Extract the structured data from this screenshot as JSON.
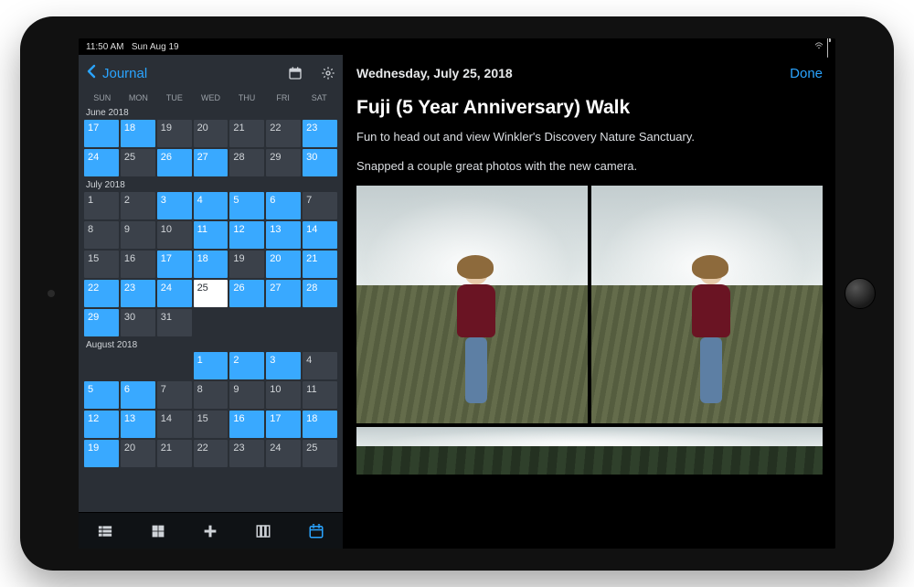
{
  "statusbar": {
    "time": "11:50 AM",
    "date": "Sun Aug 19"
  },
  "sidebar": {
    "back_label": "Journal",
    "weekdays": [
      "SUN",
      "MON",
      "TUE",
      "WED",
      "THU",
      "FRI",
      "SAT"
    ]
  },
  "calendar": {
    "months": [
      {
        "label": "June 2018",
        "rows": [
          [
            {
              "n": 17,
              "hl": true
            },
            {
              "n": 18,
              "hl": true
            },
            {
              "n": 19
            },
            {
              "n": 20
            },
            {
              "n": 21
            },
            {
              "n": 22
            },
            {
              "n": 23,
              "hl": true
            }
          ],
          [
            {
              "n": 24,
              "hl": true
            },
            {
              "n": 25
            },
            {
              "n": 26,
              "hl": true
            },
            {
              "n": 27,
              "hl": true
            },
            {
              "n": 28
            },
            {
              "n": 29
            },
            {
              "n": 30,
              "hl": true
            }
          ]
        ]
      },
      {
        "label": "July 2018",
        "rows": [
          [
            {
              "n": 1
            },
            {
              "n": 2
            },
            {
              "n": 3,
              "hl": true
            },
            {
              "n": 4,
              "hl": true
            },
            {
              "n": 5,
              "hl": true
            },
            {
              "n": 6,
              "hl": true
            },
            {
              "n": 7
            }
          ],
          [
            {
              "n": 8
            },
            {
              "n": 9
            },
            {
              "n": 10
            },
            {
              "n": 11,
              "hl": true
            },
            {
              "n": 12,
              "hl": true
            },
            {
              "n": 13,
              "hl": true
            },
            {
              "n": 14,
              "hl": true
            }
          ],
          [
            {
              "n": 15
            },
            {
              "n": 16
            },
            {
              "n": 17,
              "hl": true
            },
            {
              "n": 18,
              "hl": true
            },
            {
              "n": 19
            },
            {
              "n": 20,
              "hl": true
            },
            {
              "n": 21,
              "hl": true
            }
          ],
          [
            {
              "n": 22,
              "hl": true
            },
            {
              "n": 23,
              "hl": true
            },
            {
              "n": 24,
              "hl": true
            },
            {
              "n": 25,
              "sel": true
            },
            {
              "n": 26,
              "hl": true
            },
            {
              "n": 27,
              "hl": true
            },
            {
              "n": 28,
              "hl": true
            }
          ],
          [
            {
              "n": 29,
              "hl": true
            },
            {
              "n": 30
            },
            {
              "n": 31
            },
            {
              "empty": true
            },
            {
              "empty": true
            },
            {
              "empty": true
            },
            {
              "empty": true
            }
          ]
        ]
      },
      {
        "label": "August 2018",
        "rows": [
          [
            {
              "empty": true
            },
            {
              "empty": true
            },
            {
              "empty": true
            },
            {
              "n": 1,
              "hl": true
            },
            {
              "n": 2,
              "hl": true
            },
            {
              "n": 3,
              "hl": true
            },
            {
              "n": 4
            }
          ],
          [
            {
              "n": 5,
              "hl": true
            },
            {
              "n": 6,
              "hl": true
            },
            {
              "n": 7
            },
            {
              "n": 8
            },
            {
              "n": 9
            },
            {
              "n": 10
            },
            {
              "n": 11
            }
          ],
          [
            {
              "n": 12,
              "hl": true
            },
            {
              "n": 13,
              "hl": true
            },
            {
              "n": 14
            },
            {
              "n": 15
            },
            {
              "n": 16,
              "hl": true
            },
            {
              "n": 17,
              "hl": true
            },
            {
              "n": 18,
              "hl": true
            }
          ],
          [
            {
              "n": 19,
              "hl": true
            },
            {
              "n": 20
            },
            {
              "n": 21
            },
            {
              "n": 22
            },
            {
              "n": 23
            },
            {
              "n": 24
            },
            {
              "n": 25
            }
          ]
        ]
      }
    ]
  },
  "bottomnav": {
    "items": [
      "list-view",
      "grid-view",
      "new-entry",
      "columns-view",
      "calendar-view"
    ],
    "active": "calendar-view"
  },
  "entry": {
    "date_header": "Wednesday, July 25, 2018",
    "done_label": "Done",
    "title": "Fuji (5 Year Anniversary) Walk",
    "paragraphs": [
      "Fun to head out and view Winkler's Discovery Nature Sanctuary.",
      "Snapped a couple great photos with the new camera."
    ],
    "photos": [
      {
        "kind": "portrait"
      },
      {
        "kind": "portrait"
      },
      {
        "kind": "landscape-wide"
      }
    ]
  },
  "colors": {
    "accent": "#2aa4ff",
    "highlight": "#39a9ff"
  }
}
